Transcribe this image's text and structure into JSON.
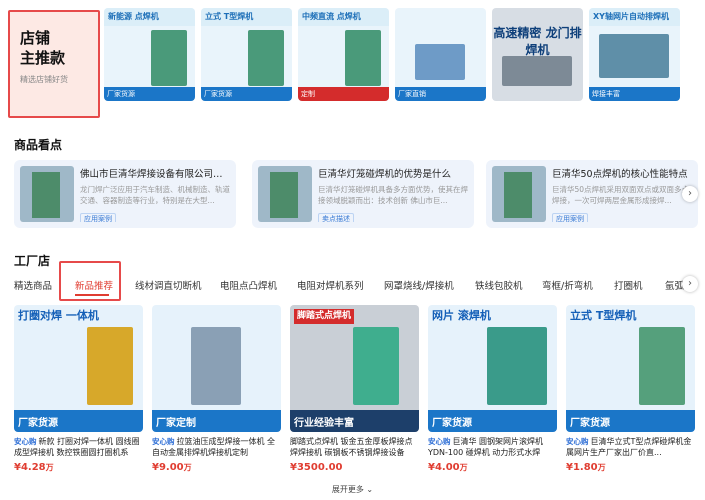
{
  "promo": {
    "title_line1": "店铺",
    "title_line2": "主推款",
    "subtitle": "精选店铺好货",
    "thumbs": [
      {
        "label": "新能源 点焊机",
        "footer": "厂家货源"
      },
      {
        "label": "立式 T型焊机",
        "footer": "厂家货源"
      },
      {
        "label": "中频直流 点焊机",
        "footer": "定制"
      },
      {
        "label": "",
        "footer": "厂家直销"
      },
      {
        "label": "高速精密 龙门排焊机",
        "footer": ""
      },
      {
        "label": "XY轴网片自动排焊机",
        "footer": "焊接丰富"
      }
    ]
  },
  "highlights": {
    "title": "商品看点",
    "items": [
      {
        "title": "佛山市巨清华焊接设备有限公司为客...",
        "desc": "龙门焊广泛应用于汽车制造、机械制造、轨道交通、容器制造等行业，特别是在大型...",
        "tag": "应用案例"
      },
      {
        "title": "巨清华灯笼碰焊机的优势是什么",
        "desc": "巨清华灯笼碰焊机具备多方面优势，使其在焊接领域脱颖而出：技术创新 佛山市巨...",
        "tag": "卖点描述"
      },
      {
        "title": "巨清华50点焊机的核心性能特点",
        "desc": "巨清华50点焊机采用双面双点或双面多点焊接，一次可焊两层金属形成接焊...",
        "tag": "应用案例"
      }
    ]
  },
  "factory": {
    "title": "工厂店",
    "tabs": [
      "精选商品",
      "新品推荐",
      "线材调直切断机",
      "电阻点凸焊机",
      "电阻对焊机系列",
      "网罩烧线/焊接机",
      "铁线包胶机",
      "弯框/折弯机",
      "打圈机",
      "氩弧"
    ]
  },
  "products": [
    {
      "img_title": "打圈对焊 一体机",
      "footer": "厂家货源",
      "badge": "安心购",
      "name": "新款 打圈对焊一体机 圆线圈成型焊接机 数控铁圈圆打圈机系列...",
      "price": "4.28",
      "unit": "万"
    },
    {
      "img_title": "",
      "footer": "厂家定制",
      "badge": "安心购",
      "name": "拉篮油压成型焊接一体机 全自动金属排焊机焊接机定制",
      "price": "9.00",
      "unit": "万"
    },
    {
      "img_title": "脚踏式点焊机",
      "footer": "行业经验丰富",
      "badge": "",
      "name": "脚踏式点焊机 钣金五金厚板焊接点焊焊接机 碳钢板不锈钢焊接设备",
      "price": "3500.00",
      "unit": ""
    },
    {
      "img_title": "网片 滚焊机",
      "footer": "厂家货源",
      "badge": "安心购",
      "name": "巨清华 圆钢架网片滚焊机 YDN-100 碰焊机 动力形式水焊 600K...",
      "price": "4.00",
      "unit": "万"
    },
    {
      "img_title": "立式 T型焊机",
      "footer": "厂家货源",
      "badge": "安心购",
      "name": "巨清华立式T型点焊碰焊机金属网片生产厂家出厂价直...",
      "price": "1.80",
      "unit": "万"
    }
  ],
  "more_label": "展开更多",
  "colors": {
    "accent": "#e03d31",
    "brand_blue": "#1b76c8"
  }
}
